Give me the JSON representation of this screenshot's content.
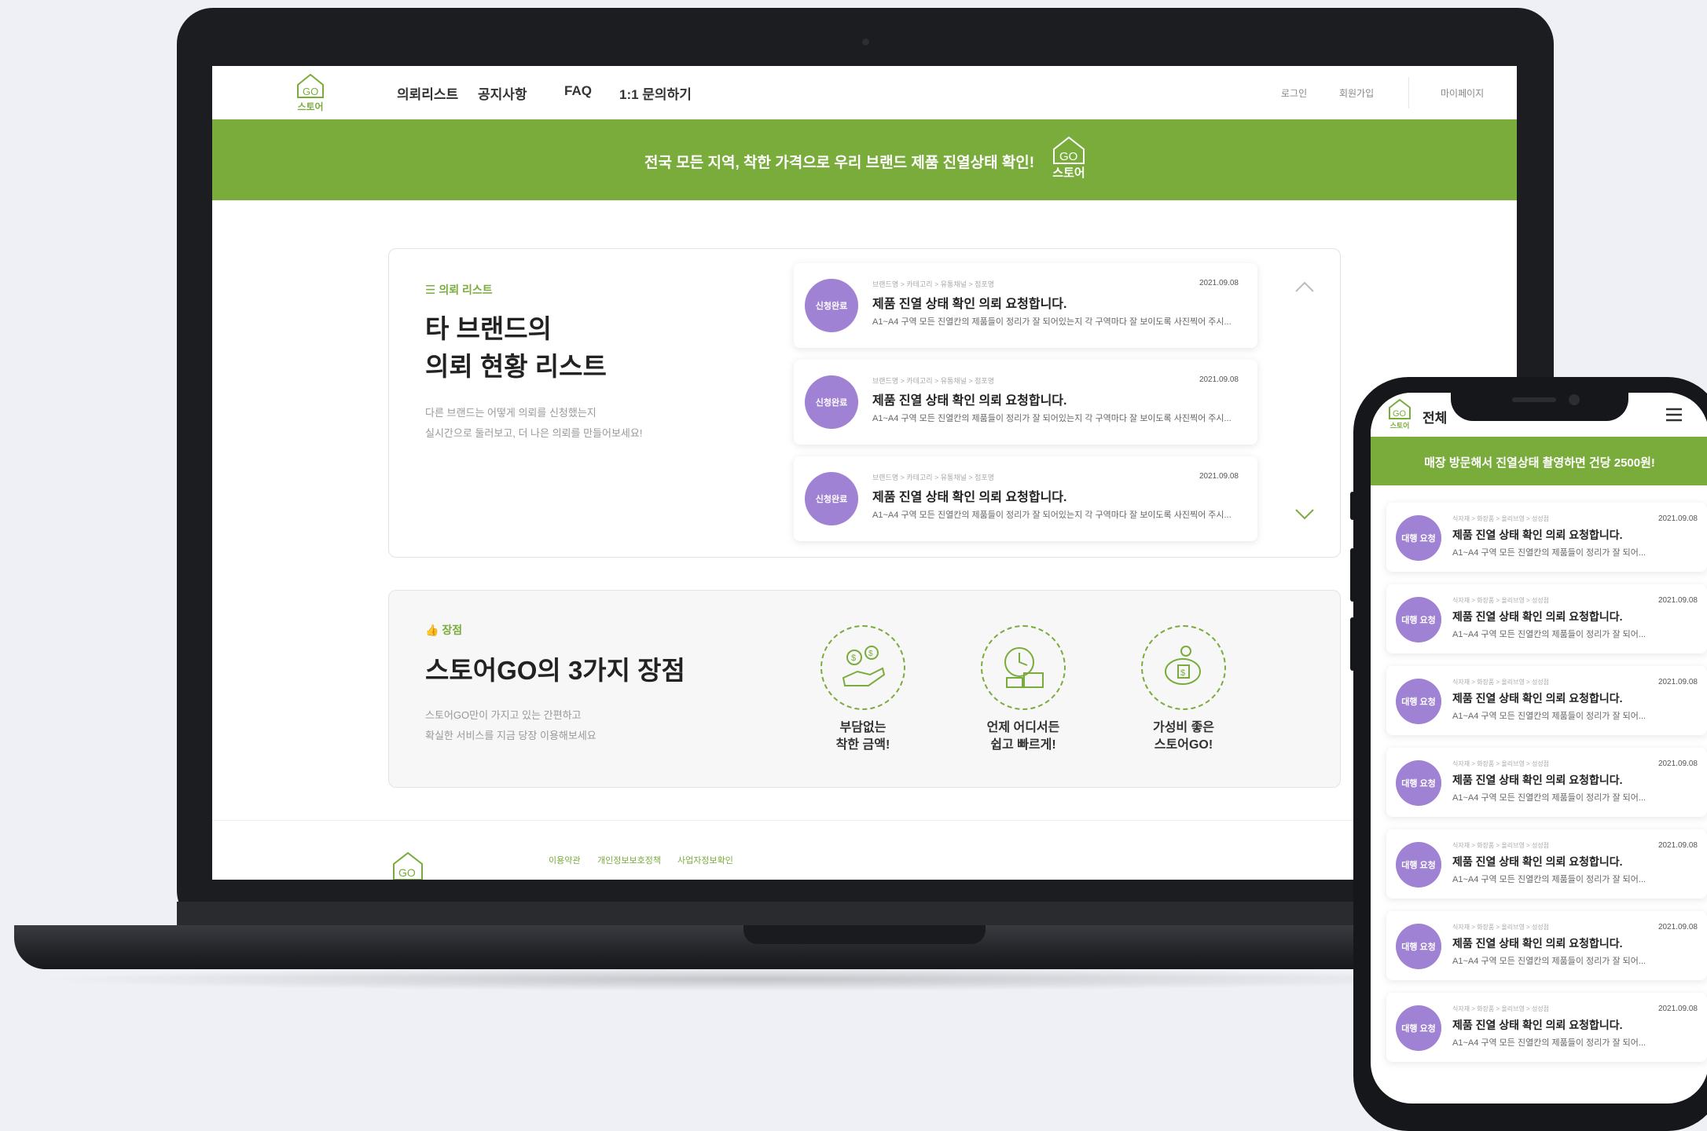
{
  "brand": {
    "logo_text": "스토어"
  },
  "nav": {
    "items": [
      "의뢰리스트",
      "공지사항",
      "FAQ",
      "1:1 문의하기"
    ]
  },
  "util": {
    "login": "로그인",
    "signup": "회원가입",
    "mypage": "마이페이지"
  },
  "banner": {
    "text": "전국 모든 지역, 착한 가격으로 우리 브랜드 제품 진열상태 확인!"
  },
  "list_section": {
    "tag": "의뢰 리스트",
    "title_line1": "타 브랜드의",
    "title_line2": "의뢰 현황 리스트",
    "desc_line1": "다른 브랜드는 어떻게 의뢰를 신청했는지",
    "desc_line2": "실시간으로 둘러보고, 더 나은 의뢰를 만들어보세요!",
    "items": [
      {
        "status": "신청완료",
        "breadcrumb": "브랜드명 > 카테고리 > 유통채널 > 점포명",
        "date": "2021.09.08",
        "title": "제품 진열 상태 확인 의뢰 요청합니다.",
        "summary": "A1~A4 구역 모든 진열칸의 제품들이 정리가 잘 되어있는지 각 구역마다 잘 보이도록 사진찍어 주시..."
      },
      {
        "status": "신청완료",
        "breadcrumb": "브랜드명 > 카테고리 > 유통채널 > 점포명",
        "date": "2021.09.08",
        "title": "제품 진열 상태 확인 의뢰 요청합니다.",
        "summary": "A1~A4 구역 모든 진열칸의 제품들이 정리가 잘 되어있는지 각 구역마다 잘 보이도록 사진찍어 주시..."
      },
      {
        "status": "신청완료",
        "breadcrumb": "브랜드명 > 카테고리 > 유통채널 > 점포명",
        "date": "2021.09.08",
        "title": "제품 진열 상태 확인 의뢰 요청합니다.",
        "summary": "A1~A4 구역 모든 진열칸의 제품들이 정리가 잘 되어있는지 각 구역마다 잘 보이도록 사진찍어 주시..."
      }
    ]
  },
  "advantages": {
    "tag": "장점",
    "title": "스토어GO의 3가지 장점",
    "desc_line1": "스토어GO만이 가지고 있는 간편하고",
    "desc_line2": "확실한 서비스를 지금 당장 이용해보세요",
    "items": [
      {
        "label": "부담없는\n착한 금액!",
        "icon": "money-hand-icon"
      },
      {
        "label": "언제 어디서든\n쉽고 빠르게!",
        "icon": "clock-box-icon"
      },
      {
        "label": "가성비 좋은\n스토어GO!",
        "icon": "piggy-bank-icon"
      }
    ]
  },
  "footer": {
    "links": [
      "이용약관",
      "개인정보보호정책",
      "사업자정보확인"
    ]
  },
  "mobile": {
    "header_title": "전체",
    "banner": "매장 방문해서 진열상태 촬영하면 건당 2500원!",
    "items": [
      {
        "status": "대행 요청",
        "breadcrumb": "식자재 > 화장품 > 올리브영 > 성성점",
        "date": "2021.09.08",
        "title": "제품 진열 상태 확인 의뢰 요청합니다.",
        "summary": "A1~A4 구역 모든 진열칸의 제품들이 정리가 잘 되어..."
      },
      {
        "status": "대행 요청",
        "breadcrumb": "식자재 > 화장품 > 올리브영 > 성성점",
        "date": "2021.09.08",
        "title": "제품 진열 상태 확인 의뢰 요청합니다.",
        "summary": "A1~A4 구역 모든 진열칸의 제품들이 정리가 잘 되어..."
      },
      {
        "status": "대행 요청",
        "breadcrumb": "식자재 > 화장품 > 올리브영 > 성성점",
        "date": "2021.09.08",
        "title": "제품 진열 상태 확인 의뢰 요청합니다.",
        "summary": "A1~A4 구역 모든 진열칸의 제품들이 정리가 잘 되어..."
      },
      {
        "status": "대행 요청",
        "breadcrumb": "식자재 > 화장품 > 올리브영 > 성성점",
        "date": "2021.09.08",
        "title": "제품 진열 상태 확인 의뢰 요청합니다.",
        "summary": "A1~A4 구역 모든 진열칸의 제품들이 정리가 잘 되어..."
      },
      {
        "status": "대행 요청",
        "breadcrumb": "식자재 > 화장품 > 올리브영 > 성성점",
        "date": "2021.09.08",
        "title": "제품 진열 상태 확인 의뢰 요청합니다.",
        "summary": "A1~A4 구역 모든 진열칸의 제품들이 정리가 잘 되어..."
      },
      {
        "status": "대행 요청",
        "breadcrumb": "식자재 > 화장품 > 올리브영 > 성성점",
        "date": "2021.09.08",
        "title": "제품 진열 상태 확인 의뢰 요청합니다.",
        "summary": "A1~A4 구역 모든 진열칸의 제품들이 정리가 잘 되어..."
      },
      {
        "status": "대행 요청",
        "breadcrumb": "식자재 > 화장품 > 올리브영 > 성성점",
        "date": "2021.09.08",
        "title": "제품 진열 상태 확인 의뢰 요청합니다.",
        "summary": "A1~A4 구역 모든 진열칸의 제품들이 정리가 잘 되어..."
      }
    ]
  },
  "colors": {
    "brand_green": "#7aac3c",
    "status_purple": "#9f82d4"
  }
}
